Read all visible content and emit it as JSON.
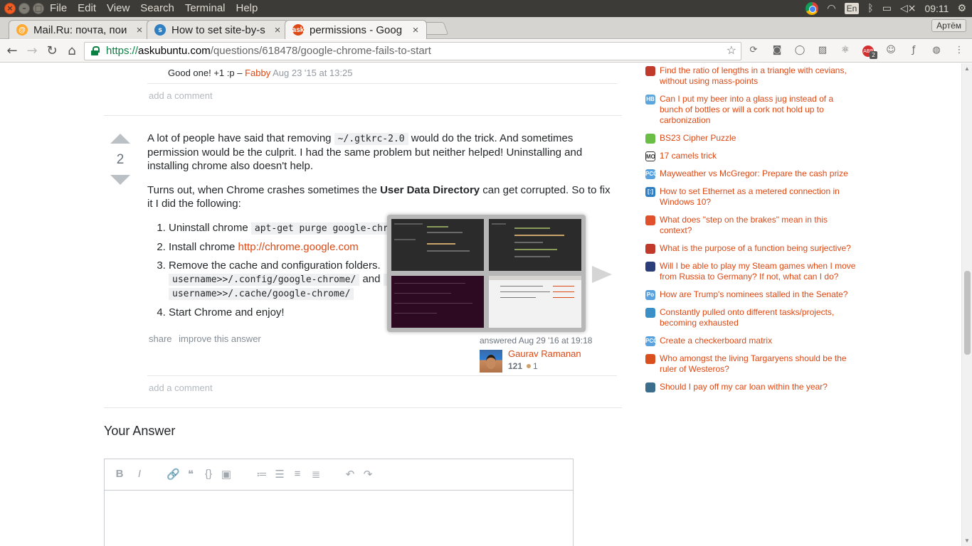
{
  "system_bar": {
    "menu": [
      "File",
      "Edit",
      "View",
      "Search",
      "Terminal",
      "Help"
    ],
    "keyboard_layout": "En",
    "time": "09:11"
  },
  "browser": {
    "tabs": [
      {
        "title": "Mail.Ru: почта, пои",
        "icon": "mailru-icon",
        "color": "#ffa930"
      },
      {
        "title": "How to set site-by-s",
        "icon": "superuser-icon",
        "color": "#2f7fc2"
      },
      {
        "title": "permissions - Goog",
        "icon": "askubuntu-icon",
        "color": "#dd4814",
        "active": true
      }
    ],
    "profile": "Артём",
    "url": {
      "scheme": "https://",
      "domain": "askubuntu.com",
      "path": "/questions/618478/google-chrome-fails-to-start"
    },
    "ext_badge": "2"
  },
  "prev_comment": {
    "text": "Good one! +1 :p – ",
    "user": "Fabby",
    "date": "Aug 23 '15 at 13:25",
    "add_comment": "add a comment"
  },
  "answer": {
    "votes": "2",
    "p1_a": "A lot of people have said that removing ",
    "p1_code": "~/.gtkrc-2.0",
    "p1_b": " would do the trick. And sometimes permission would be the culprit. I had the same problem but neither helped! Uninstalling and installing chrome also doesn't help.",
    "p2_a": "Turns out, when Chrome crashes sometimes the ",
    "p2_bold": "User Data Directory",
    "p2_b": " can get corrupted. So to fix it I did the following:",
    "step1_text": "Uninstall chrome ",
    "step1_code": "apt-get purge google-chro",
    "step2_text": "Install chrome ",
    "step2_link": "http://chrome.google.com",
    "step3_text": "Remove the cache and configuration folders. ",
    "step3_code1": "username>>/.config/google-chrome/",
    "step3_and": " and ",
    "step3_code2": "rm",
    "step3_code3": "username>>/.cache/google-chrome/",
    "step4_text": "Start Chrome and enjoy!",
    "menu": [
      "share",
      "improve this answer"
    ],
    "answered": "answered Aug 29 '16 at 19:18",
    "author": "Gaurav Ramanan",
    "rep": "121",
    "bronze": "1",
    "add_comment": "add a comment"
  },
  "your_answer": {
    "heading": "Your Answer",
    "toolbar": [
      "B",
      "I",
      "🔗",
      "❝",
      "{}",
      "▣",
      "≔",
      "☰",
      "≡",
      "≣",
      "↶",
      "↷"
    ]
  },
  "hot_questions": [
    {
      "title": "Find the ratio of lengths in a triangle with cevians, without using mass-points",
      "icon": "math-icon",
      "color": "#c0392b"
    },
    {
      "title": "Can I put my beer into a glass jug instead of a bunch of bottles or will a cork not hold up to carbonization",
      "icon": "homebrew-icon",
      "color": "#5da6dd"
    },
    {
      "title": "BS23 Cipher Puzzle",
      "icon": "puzzling-icon",
      "color": "#6abd45"
    },
    {
      "title": "17 camels trick",
      "icon": "mathoverflow-icon",
      "color": "#333333"
    },
    {
      "title": "Mayweather vs McGregor: Prepare the cash prize",
      "icon": "codegolf-icon",
      "color": "#5aa2dd"
    },
    {
      "title": "How to set Ethernet as a metered connection in Windows 10?",
      "icon": "superuser-icon",
      "color": "#2f7fc2"
    },
    {
      "title": "What does \"step on the brakes\" mean in this context?",
      "icon": "ell-icon",
      "color": "#e0502b"
    },
    {
      "title": "What is the purpose of a function being surjective?",
      "icon": "math-icon",
      "color": "#c0392b"
    },
    {
      "title": "Will I be able to play my Steam games when I move from Russia to Germany? If not, what can I do?",
      "icon": "gaming-icon",
      "color": "#2c3e7a"
    },
    {
      "title": "How are Trump's nominees stalled in the Senate?",
      "icon": "politics-icon",
      "color": "#5aa2dd"
    },
    {
      "title": "Constantly pulled onto different tasks/projects, becoming exhausted",
      "icon": "workplace-icon",
      "color": "#3a8fc6"
    },
    {
      "title": "Create a checkerboard matrix",
      "icon": "codegolf-icon",
      "color": "#5aa2dd"
    },
    {
      "title": "Who amongst the living Targaryens should be the ruler of Westeros?",
      "icon": "scifi-icon",
      "color": "#d9501e"
    },
    {
      "title": "Should I pay off my car loan within the year?",
      "icon": "money-icon",
      "color": "#3b6d8c"
    }
  ]
}
